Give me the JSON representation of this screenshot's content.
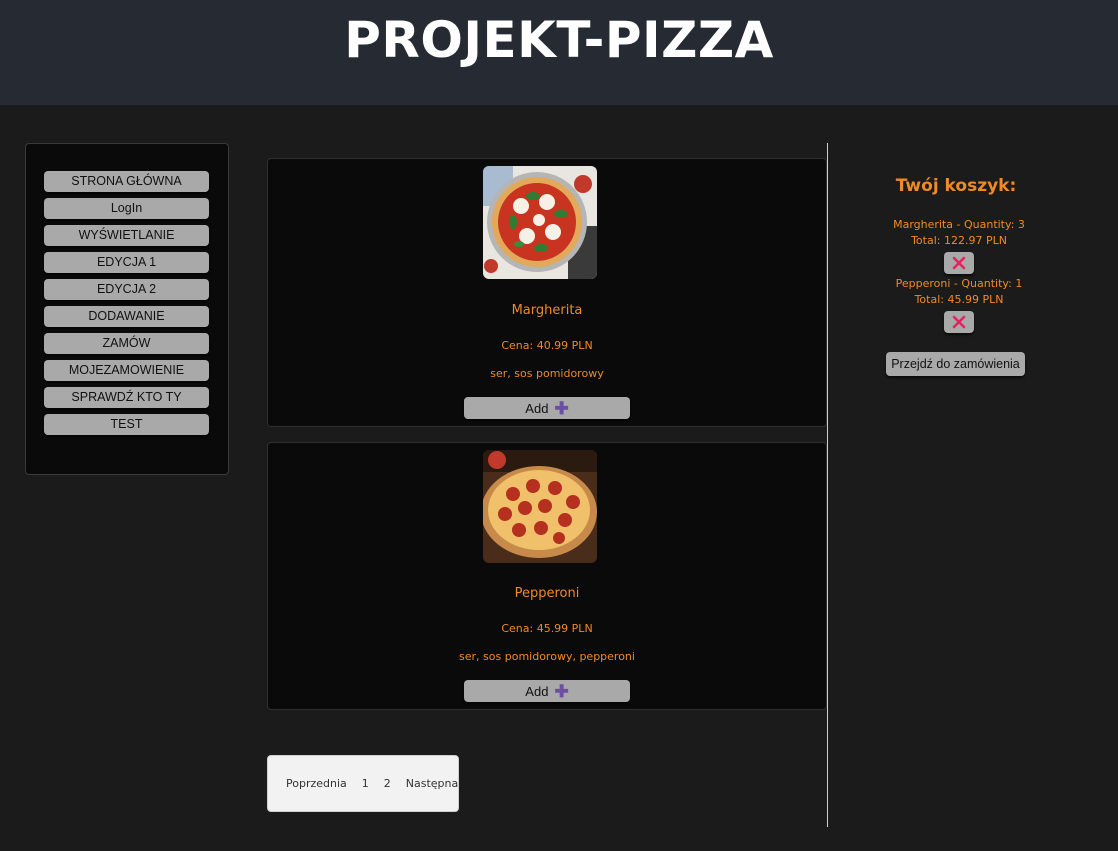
{
  "header": {
    "title": "PROJEKT-PIZZA"
  },
  "sidebar": {
    "items": [
      {
        "label": "STRONA GŁÓWNA"
      },
      {
        "label": "LogIn"
      },
      {
        "label": "WYŚWIETLANIE"
      },
      {
        "label": "EDYCJA 1"
      },
      {
        "label": "EDYCJA 2"
      },
      {
        "label": "DODAWANIE"
      },
      {
        "label": "ZAMÓW"
      },
      {
        "label": "MOJEZAMOWIENIE"
      },
      {
        "label": "SPRAWDŹ KTO TY"
      },
      {
        "label": "TEST"
      }
    ]
  },
  "products": [
    {
      "name": "Margherita",
      "price": "Cena: 40.99 PLN",
      "ingredients": "ser, sos pomidorowy",
      "add_label": "Add",
      "add_icon": "plus-icon"
    },
    {
      "name": "Pepperoni",
      "price": "Cena: 45.99 PLN",
      "ingredients": "ser, sos pomidorowy, pepperoni",
      "add_label": "Add",
      "add_icon": "plus-icon"
    }
  ],
  "pagination": {
    "prev": "Poprzednia",
    "page1": "1",
    "page2": "2",
    "next": "Następna"
  },
  "cart": {
    "title": "Twój koszyk:",
    "items": [
      {
        "line": "Margherita - Quantity: 3",
        "total": "Total: 122.97 PLN",
        "remove_icon": "close-icon"
      },
      {
        "line": "Pepperoni - Quantity: 1",
        "total": "Total: 45.99 PLN",
        "remove_icon": "close-icon"
      }
    ],
    "checkout_label": "Przejdź do zamówienia"
  },
  "colors": {
    "accent": "#f08a24",
    "header_bg": "#262a33",
    "page_bg": "#1b1b1b",
    "button_bg": "#a9a9a9",
    "remove_x": "#e0245e",
    "plus": "#6b4fa3"
  }
}
